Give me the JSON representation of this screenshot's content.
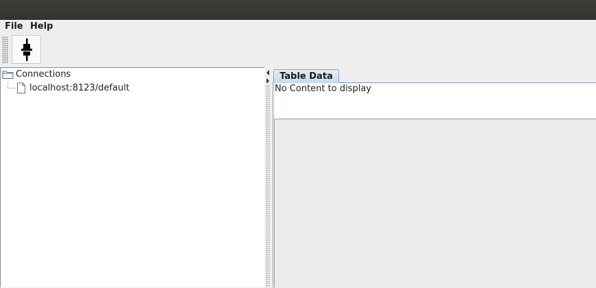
{
  "menubar": {
    "items": [
      {
        "label": "File"
      },
      {
        "label": "Help"
      }
    ]
  },
  "toolbar": {
    "connect_icon": "plug-connect-icon"
  },
  "tree": {
    "root": {
      "label": "Connections",
      "icon": "folder-icon"
    },
    "children": [
      {
        "label": "localhost:8123/default",
        "icon": "file-icon"
      }
    ]
  },
  "tabs": [
    {
      "label": "Table Data",
      "selected": true
    }
  ],
  "content": {
    "message": "No Content to display"
  },
  "colors": {
    "titlebar": "#3a3935",
    "tab_selected": "#c9d9ec",
    "tab_border": "#8aa0bd",
    "background": "#eeeeee"
  }
}
